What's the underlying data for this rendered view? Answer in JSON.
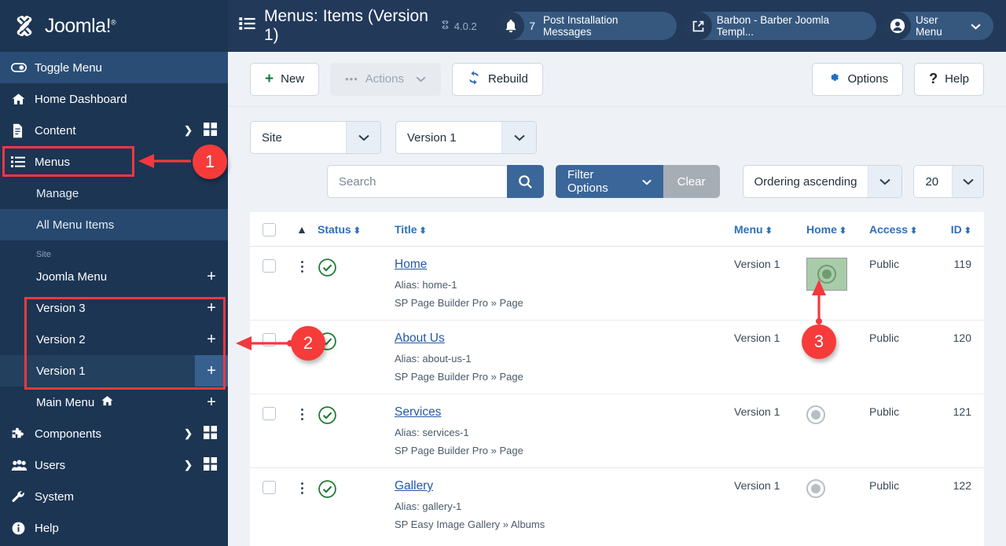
{
  "brand": {
    "name": "Joomla!",
    "registered": "®"
  },
  "sidebar": {
    "toggle_label": "Toggle Menu",
    "items": [
      {
        "label": "Home Dashboard",
        "icon": "home-icon"
      },
      {
        "label": "Content",
        "icon": "document-icon"
      },
      {
        "label": "Menus",
        "icon": "list-icon"
      }
    ],
    "menus_sub": [
      {
        "label": "Manage"
      },
      {
        "label": "All Menu Items"
      }
    ],
    "site_group_label": "Site",
    "menu_list": [
      {
        "label": "Joomla Menu",
        "add": "+",
        "selected": false,
        "home": false
      },
      {
        "label": "Version 3",
        "add": "+",
        "selected": false,
        "home": false
      },
      {
        "label": "Version 2",
        "add": "+",
        "selected": false,
        "home": false
      },
      {
        "label": "Version 1",
        "add": "+",
        "selected": true,
        "home": false
      },
      {
        "label": "Main Menu",
        "add": "+",
        "selected": false,
        "home": true
      }
    ],
    "bottom_items": [
      {
        "label": "Components",
        "icon": "puzzle-icon"
      },
      {
        "label": "Users",
        "icon": "users-icon"
      },
      {
        "label": "System",
        "icon": "wrench-icon"
      },
      {
        "label": "Help",
        "icon": "info-icon"
      }
    ]
  },
  "header": {
    "title": "Menus: Items (Version 1)",
    "version": "4.0.2",
    "notifications_count": "7",
    "notifications_label": "Post Installation Messages",
    "site_link_label": "Barbon - Barber Joomla Templ...",
    "user_menu_label": "User Menu"
  },
  "toolbar": {
    "new_label": "New",
    "actions_label": "Actions",
    "rebuild_label": "Rebuild",
    "options_label": "Options",
    "help_label": "Help"
  },
  "filters": {
    "site_select": "Site",
    "version_select": "Version 1",
    "search_placeholder": "Search",
    "search_value": "",
    "filter_options_label": "Filter Options",
    "clear_label": "Clear",
    "ordering_select": "Ordering ascending",
    "limit_select": "20"
  },
  "table": {
    "columns": {
      "status": "Status",
      "title": "Title",
      "menu": "Menu",
      "home": "Home",
      "access": "Access",
      "id": "ID"
    },
    "rows": [
      {
        "title": "Home",
        "alias": "Alias: home-1",
        "component": "SP Page Builder Pro » Page",
        "menu": "Version 1",
        "home": true,
        "home_highlighted": true,
        "access": "Public",
        "id": "119",
        "show_actions": true
      },
      {
        "title": "About Us",
        "alias": "Alias: about-us-1",
        "component": "SP Page Builder Pro » Page",
        "menu": "Version 1",
        "home": false,
        "home_highlighted": false,
        "access": "Public",
        "id": "120",
        "show_actions": false
      },
      {
        "title": "Services",
        "alias": "Alias: services-1",
        "component": "SP Page Builder Pro » Page",
        "menu": "Version 1",
        "home": false,
        "home_highlighted": false,
        "access": "Public",
        "id": "121",
        "show_actions": true
      },
      {
        "title": "Gallery",
        "alias": "Alias: gallery-1",
        "component": "SP Easy Image Gallery » Albums",
        "menu": "Version 1",
        "home": false,
        "home_highlighted": false,
        "access": "Public",
        "id": "122",
        "show_actions": true
      }
    ]
  },
  "annotations": {
    "markers": [
      {
        "number": "1"
      },
      {
        "number": "2"
      },
      {
        "number": "3"
      }
    ],
    "color": "#f73b3b"
  }
}
